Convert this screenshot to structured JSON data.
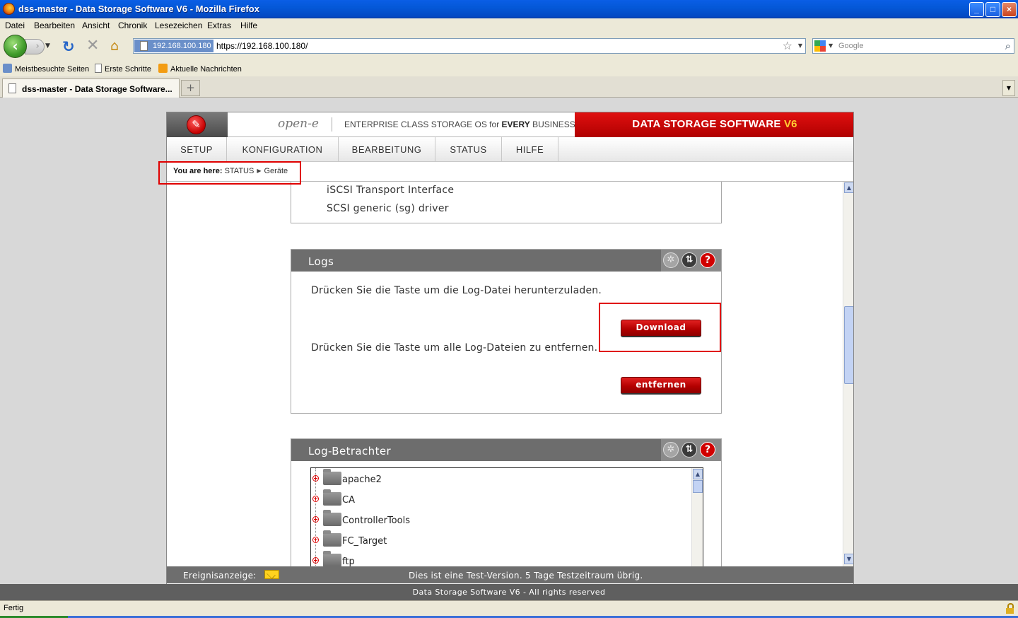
{
  "window": {
    "title": "dss-master - Data Storage Software V6 - Mozilla Firefox",
    "controls": {
      "minimize": "_",
      "maximize": "□",
      "close": "×"
    }
  },
  "menu": [
    "Datei",
    "Bearbeiten",
    "Ansicht",
    "Chronik",
    "Lesezeichen",
    "Extras",
    "Hilfe"
  ],
  "nav": {
    "site_identity": "192.168.100.180",
    "url": "https://192.168.100.180/",
    "search_placeholder": "Google"
  },
  "bookmarks": [
    "Meistbesuchte Seiten",
    "Erste Schritte",
    "Aktuelle Nachrichten"
  ],
  "tab": {
    "label": "dss-master - Data Storage Software..."
  },
  "header": {
    "brand": "open-e",
    "tagline_pre": "ENTERPRISE CLASS STORAGE OS for ",
    "tagline_bold": "EVERY",
    "tagline_post": " BUSINESS",
    "product": "DATA STORAGE SOFTWARE ",
    "product_version": "V6"
  },
  "main_nav": [
    "SETUP",
    "KONFIGURATION",
    "BEARBEITUNG",
    "STATUS",
    "HILFE"
  ],
  "breadcrumb": {
    "prefix": "You are here:",
    "section": "STATUS",
    "page": "Geräte"
  },
  "drivers_box": {
    "lines": [
      "iSCSI Transport Interface",
      "SCSI generic (sg) driver"
    ]
  },
  "logs_box": {
    "title": "Logs",
    "download_text": "Drücken Sie die Taste um die Log-Datei herunterzuladen.",
    "download_button": "Download",
    "remove_text": "Drücken Sie die Taste um alle Log-Dateien zu entfernen.",
    "remove_button": "entfernen"
  },
  "viewer_box": {
    "title": "Log-Betrachter",
    "folders": [
      "apache2",
      "CA",
      "ControllerTools",
      "FC_Target",
      "ftp"
    ]
  },
  "status_bar_app": {
    "label": "Ereignisanzeige:",
    "trial": "Dies ist eine Test-Version. 5 Tage Testzeitraum übrig."
  },
  "copyright": "Data Storage Software V6 - All rights reserved",
  "browser_status": "Fertig",
  "colors": {
    "accent_red": "#c60000",
    "header_gray": "#6d6d6d",
    "highlight": "#e00000"
  }
}
